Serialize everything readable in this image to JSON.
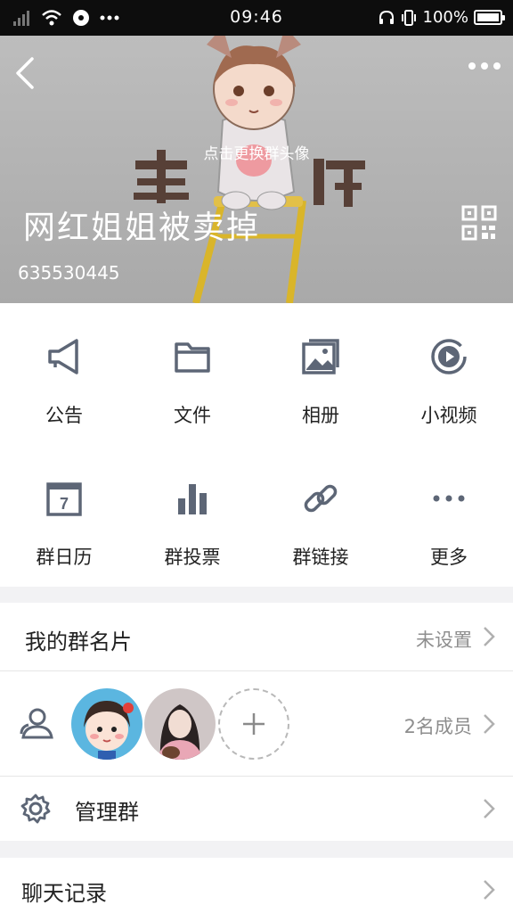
{
  "status_bar": {
    "time": "09:46",
    "battery": "100%",
    "battery_level": 1.0
  },
  "header": {
    "change_avatar_hint": "点击更换群头像",
    "group_name": "网红姐姐被卖掉",
    "group_id": "635530445"
  },
  "features": [
    {
      "label": "公告",
      "icon": "megaphone-icon"
    },
    {
      "label": "文件",
      "icon": "folder-icon"
    },
    {
      "label": "相册",
      "icon": "photo-album-icon"
    },
    {
      "label": "小视频",
      "icon": "video-play-icon"
    },
    {
      "label": "群日历",
      "icon": "calendar-icon"
    },
    {
      "label": "群投票",
      "icon": "bar-chart-icon"
    },
    {
      "label": "群链接",
      "icon": "link-icon"
    },
    {
      "label": "更多",
      "icon": "more-dots-icon"
    }
  ],
  "calendar_day": "7",
  "my_card": {
    "label": "我的群名片",
    "value": "未设置"
  },
  "members": {
    "count_text": "2名成员"
  },
  "manage": {
    "label": "管理群"
  },
  "chat_history": {
    "label": "聊天记录"
  }
}
